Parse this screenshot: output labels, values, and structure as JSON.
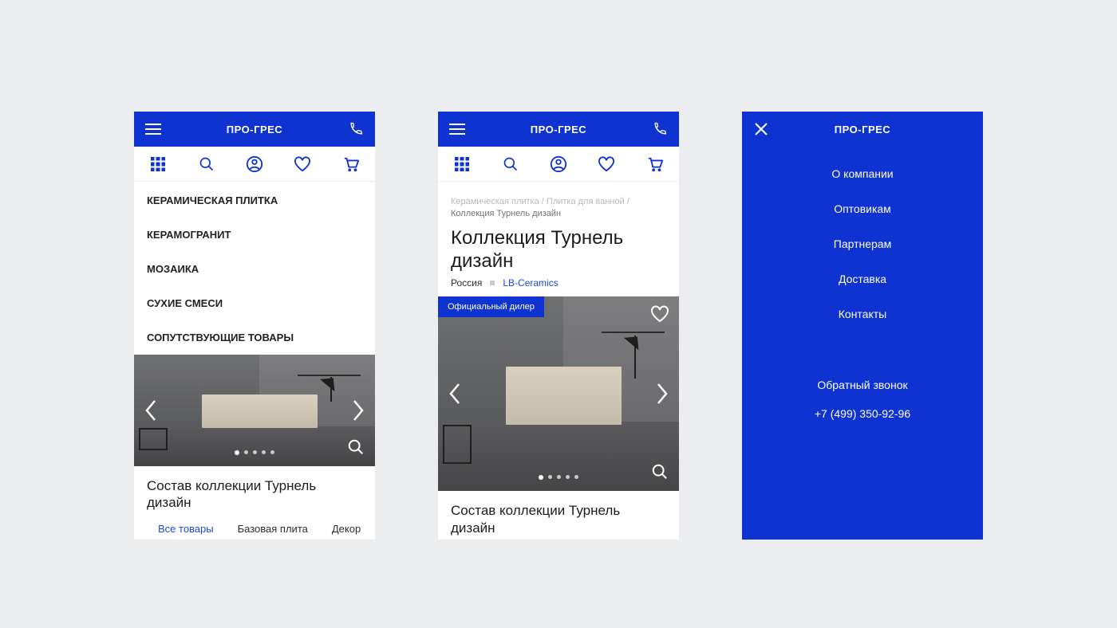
{
  "brand": "ПРО-ГРЕС",
  "categories": [
    "КЕРАМИЧЕСКАЯ ПЛИТКА",
    "КЕРАМОГРАНИТ",
    "МОЗАИКА",
    "СУХИЕ СМЕСИ",
    "СОПУТСТВУЮЩИЕ ТОВАРЫ"
  ],
  "breadcrumb": {
    "p1": "Керамическая плитка",
    "p2": "Плитка для ванной",
    "current": "Коллекция Турнель дизайн"
  },
  "page_title": "Коллекция Турнель дизайн",
  "meta": {
    "country": "Россия",
    "brand": "LB-Ceramics"
  },
  "badge": "Официальный дилер",
  "subheading": "Состав коллекции Турнель дизайн",
  "tabs": {
    "t1": "Все товары",
    "t2": "Базовая плита",
    "t3": "Декор"
  },
  "menu": {
    "items": [
      "О компании",
      "Оптовикам",
      "Партнерам",
      "Доставка",
      "Контакты"
    ],
    "callback": "Обратный звонок",
    "phone": "+7 (499) 350-92-96"
  }
}
